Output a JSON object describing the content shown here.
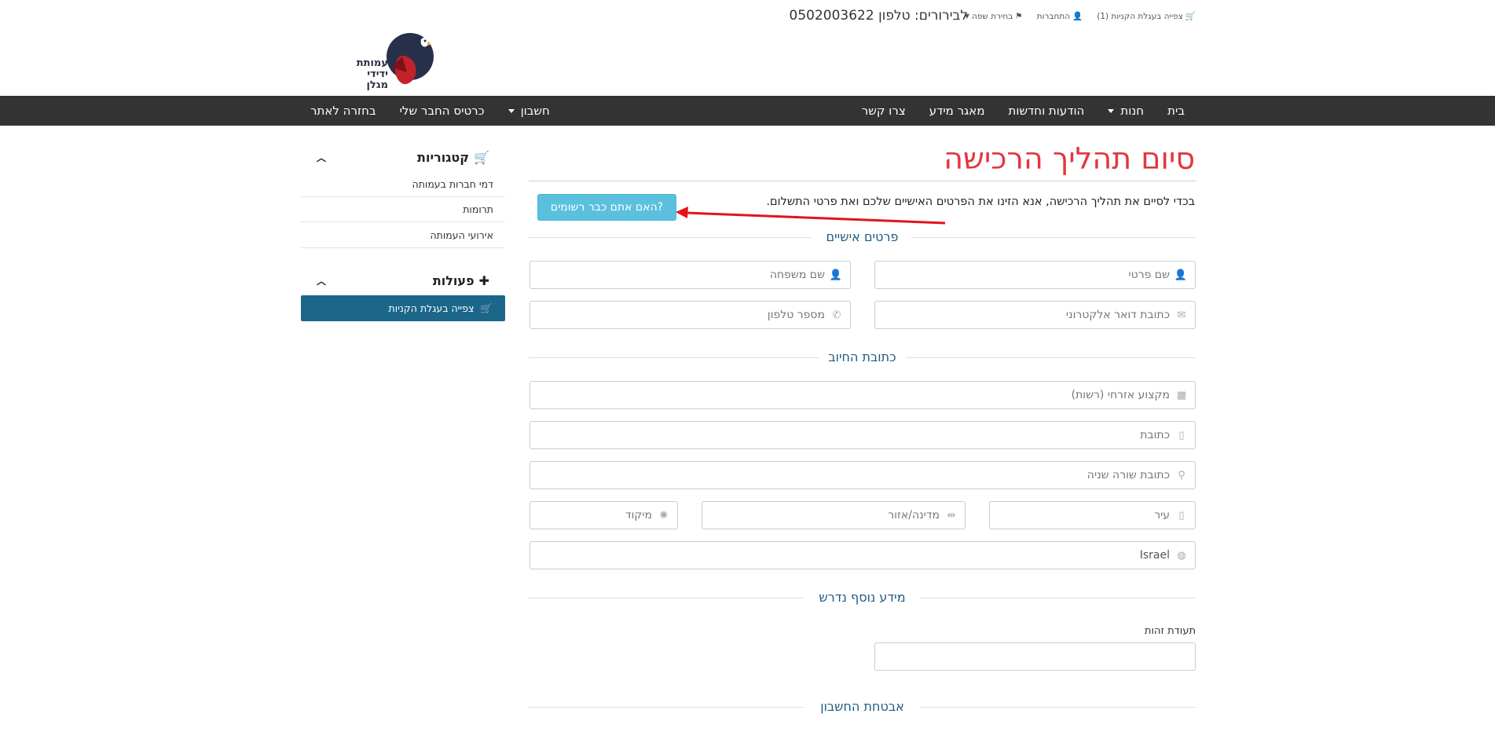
{
  "topbar": {
    "contact": "לבירורים: טלפון 0502003622",
    "cart_link": "צפייה בעגלת הקניות (1)",
    "login_link": "התחברות",
    "language_link": "בחירת שפה"
  },
  "logo": {
    "line1": "עמותת",
    "line2": "ידידי מגלן"
  },
  "nav": {
    "right": [
      "בית",
      "חנות",
      "הודעות וחדשות",
      "מאגר מידע",
      "צרו קשר"
    ],
    "left": [
      "חשבון",
      "כרטיס החבר שלי",
      "בחזרה לאתר"
    ]
  },
  "main": {
    "title": "סיום תהליך הרכישה",
    "intro": "בכדי לסיים את תהליך הרכישה, אנא הזינו את הפרטים האישיים שלכם ואת פרטי התשלום.",
    "login_button": "?האם אתם כבר רשומים",
    "sections": {
      "personal": "פרטים אישיים",
      "billing": "כתובת החיוב",
      "extra": "מידע נוסף נדרש",
      "security": "אבטחת החשבון"
    },
    "fields": {
      "first_name": "שם פרטי",
      "last_name": "שם משפחה",
      "email": "כתובת דואר אלקטרוני",
      "phone": "מספר טלפון",
      "profession": "מקצוע אזרחי (רשות)",
      "address": "כתובת",
      "address2": "כתובת שורה שניה",
      "city": "עיר",
      "state": "מדינה/אזור",
      "zip": "מיקוד",
      "country": "Israel"
    },
    "id_label": "תעודת זהות"
  },
  "sidebar": {
    "categories_title": "קטגוריות",
    "categories": [
      "דמי חברות בעמותה",
      "תרומות",
      "אירועי העמותה"
    ],
    "actions_title": "פעולות",
    "view_cart": "צפייה בעגלת הקניות"
  },
  "colors": {
    "title": "#e4363c",
    "section": "#1f5a82",
    "navbar": "#333333",
    "info_button": "#5bc0de",
    "sidebar_button": "#1b6689",
    "annotation_arrow": "#e3131b"
  }
}
